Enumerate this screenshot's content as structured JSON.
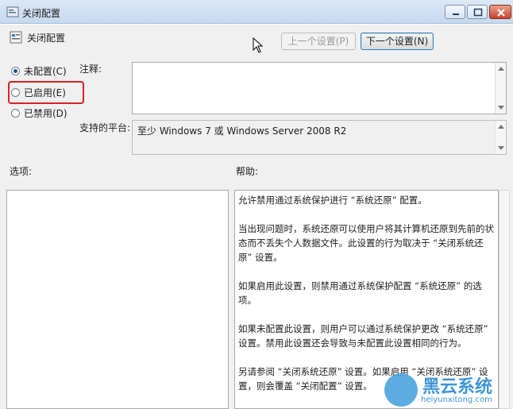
{
  "window": {
    "title": "关闭配置"
  },
  "header": {
    "title": "关闭配置",
    "prev_label": "上一个设置(P)",
    "next_label": "下一个设置(N)"
  },
  "state": {
    "options": [
      {
        "label": "未配置(C)",
        "selected": true
      },
      {
        "label": "已启用(E)",
        "selected": false,
        "highlighted": true
      },
      {
        "label": "已禁用(D)",
        "selected": false
      }
    ]
  },
  "fields": {
    "comment_label": "注释:",
    "comment_value": "",
    "platform_label": "支持的平台:",
    "platform_value": "至少 Windows 7 或 Windows Server 2008 R2"
  },
  "sections": {
    "options_label": "选项:",
    "help_label": "帮助:"
  },
  "help": {
    "paragraphs": [
      "允许禁用通过系统保护进行 “系统还原” 配置。",
      "当出现问题时，系统还原可以使用户将其计算机还原到先前的状态而不丢失个人数据文件。此设置的行为取决于 “关闭系统还原” 设置。",
      "如果启用此设置，则禁用通过系统保护配置 “系统还原” 的选项。",
      "如果未配置此设置，则用户可以通过系统保护更改 “系统还原” 设置。禁用此设置还会导致与未配置此设置相同的行为。",
      "另请参阅 “关闭系统还原” 设置。如果启用 “关闭系统还原” 设置，则会覆盖 “关闭配置” 设置。"
    ]
  },
  "watermark": {
    "brand": "黑云系统",
    "url": "heiyunxitong.com"
  },
  "colors": {
    "highlight": "#e02020",
    "titlebar": "#c7d9ee",
    "watermark": "#2a8bd2"
  }
}
